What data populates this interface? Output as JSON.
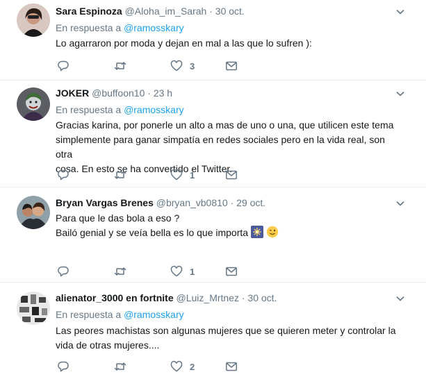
{
  "common": {
    "in_reply_prefix": "En respuesta a",
    "dot": "·"
  },
  "tweets": [
    {
      "name": "Sara Espinoza",
      "handle": "@Aloha_im_Sarah",
      "time": "30 oct.",
      "reply_to": "@ramosskary",
      "lines": [
        "Lo agarraron por moda y dejan en mal a las que lo sufren ):"
      ],
      "likes": "3"
    },
    {
      "name": "JOKER",
      "handle": "@buffoon10",
      "time": "23 h",
      "reply_to": "@ramosskary",
      "lines": [
        "Gracias karina, por ponerle un alto a mas de uno o una, que utilicen este tema",
        "simplemente para ganar simpatía en redes sociales pero en la vida real, son otra",
        "cosa. En esto se ha convertido el Twitter."
      ],
      "likes": "1"
    },
    {
      "name": "Bryan Vargas Brenes",
      "handle": "@bryan_vb0810",
      "time": "29 oct.",
      "reply_to": "",
      "lines": [
        "Para que le das bola a eso ?",
        "Bailó genial y se veía bella es lo que importa"
      ],
      "likes": "1"
    },
    {
      "name": "alienator_3000 en fortnite",
      "handle": "@Luiz_Mrtnez",
      "time": "30 oct.",
      "reply_to": "@ramosskary",
      "lines": [
        "Las peores machistas son algunas mujeres que se quieren meter y controlar la",
        "vida de otras mujeres...."
      ],
      "likes": "2"
    }
  ],
  "icons": {
    "reply": "reply-icon",
    "retweet": "retweet-icon",
    "like": "heart-icon",
    "message": "envelope-icon",
    "menu": "chevron-down-icon"
  },
  "colors": {
    "accent": "#1da1f2",
    "muted": "#657786",
    "divider": "#e6ecf0"
  }
}
